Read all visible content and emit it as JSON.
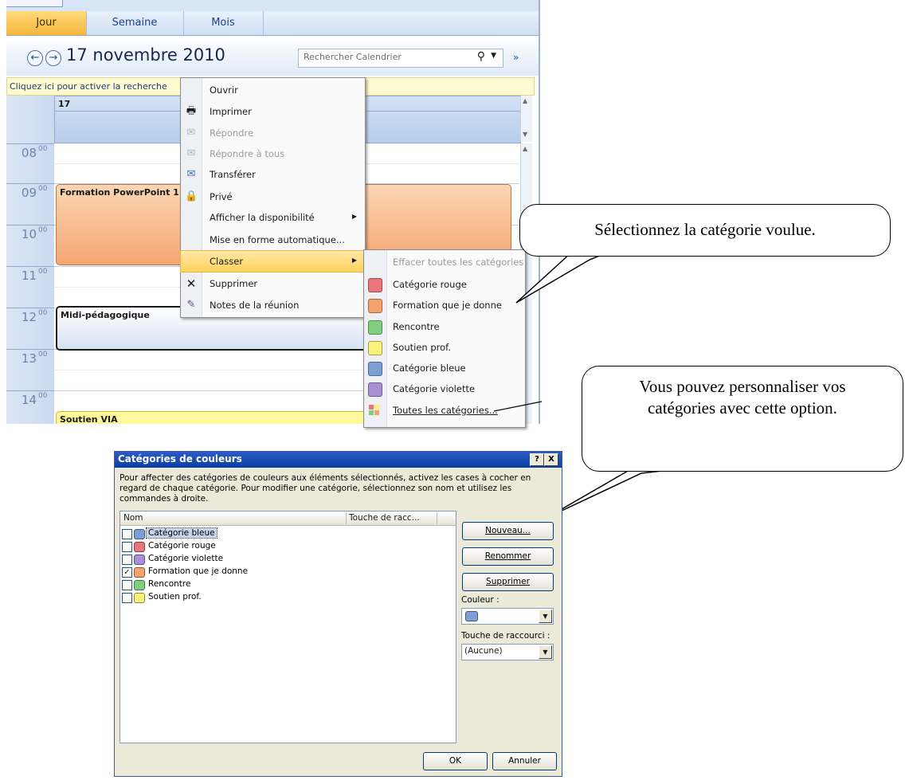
{
  "calendar": {
    "tabs": [
      "Jour",
      "Semaine",
      "Mois"
    ],
    "date_title": "17 novembre 2010",
    "search_placeholder": "Rechercher Calendrier",
    "info_bar": "Cliquez ici pour activer la recherche",
    "day_number": "17",
    "hours": [
      {
        "h": "08",
        "m": "00"
      },
      {
        "h": "09",
        "m": "00"
      },
      {
        "h": "10",
        "m": "00"
      },
      {
        "h": "11",
        "m": "00"
      },
      {
        "h": "12",
        "m": "00"
      },
      {
        "h": "13",
        "m": "00"
      },
      {
        "h": "14",
        "m": "00"
      }
    ],
    "appointments": [
      "Formation PowerPoint 1",
      "Midi-pédagogique",
      "Soutien VIA"
    ]
  },
  "context_menu": {
    "items": [
      {
        "label": "Ouvrir",
        "icon": "none"
      },
      {
        "label": "Imprimer",
        "icon": "printer-icon"
      },
      {
        "label": "Répondre",
        "icon": "reply-icon",
        "disabled": true
      },
      {
        "label": "Répondre à tous",
        "icon": "reply-all-icon",
        "disabled": true
      },
      {
        "label": "Transférer",
        "icon": "forward-icon"
      },
      {
        "label": "Privé",
        "icon": "lock-icon"
      },
      {
        "label": "Afficher la disponibilité",
        "icon": "none",
        "submenu": true
      },
      {
        "label": "Mise en forme automatique...",
        "icon": "none"
      },
      {
        "label": "Classer",
        "icon": "none",
        "submenu": true,
        "highlighted": true
      },
      {
        "label": "Supprimer",
        "icon": "delete-x-icon"
      },
      {
        "label": "Notes de la réunion",
        "icon": "notes-icon"
      }
    ]
  },
  "classify_submenu": {
    "items": [
      {
        "label": "Effacer toutes les catégories",
        "disabled": true
      },
      {
        "label": "Catégorie rouge",
        "color": "#e8767a"
      },
      {
        "label": "Formation que je donne",
        "color": "#f5a26a"
      },
      {
        "label": "Rencontre",
        "color": "#7fcf7f"
      },
      {
        "label": "Soutien prof.",
        "color": "#fbf27a"
      },
      {
        "label": "Catégorie bleue",
        "color": "#7c9fd6"
      },
      {
        "label": "Catégorie violette",
        "color": "#a98fd6"
      },
      {
        "label": "Toutes les catégories...",
        "icon": "all-categories-icon"
      }
    ]
  },
  "callouts": {
    "top": "Sélectionnez la catégorie voulue.",
    "bottom": "Vous pouvez personnaliser vos catégories avec cette option."
  },
  "dialog": {
    "title": "Catégories de couleurs",
    "help_btn": "?",
    "close_btn": "X",
    "instructions": "Pour affecter des catégories de couleurs aux éléments sélectionnés, activez les cases à cocher en regard de chaque catégorie. Pour modifier une catégorie, sélectionnez son nom et utilisez les commandes à droite.",
    "columns": [
      "Nom",
      "Touche de racc..."
    ],
    "rows": [
      {
        "label": "Catégorie bleue",
        "color": "#7c9fd6",
        "checked": false,
        "selected": true
      },
      {
        "label": "Catégorie rouge",
        "color": "#e8767a",
        "checked": false
      },
      {
        "label": "Catégorie violette",
        "color": "#a98fd6",
        "checked": false
      },
      {
        "label": "Formation que je donne",
        "color": "#f5a26a",
        "checked": true
      },
      {
        "label": "Rencontre",
        "color": "#7fcf7f",
        "checked": false
      },
      {
        "label": "Soutien prof.",
        "color": "#fbf27a",
        "checked": false
      }
    ],
    "buttons": {
      "new": "Nouveau...",
      "rename": "Renommer",
      "delete": "Supprimer",
      "ok": "OK",
      "cancel": "Annuler"
    },
    "color_label": "Couleur :",
    "color_value": "#7c9fd6",
    "shortcut_label": "Touche de raccourci :",
    "shortcut_value": "(Aucune)"
  },
  "colors": {
    "outlook_blue": "#15428b",
    "tab_active": "#f6b73c",
    "menu_highlight": "#ffd35c",
    "dialog_title": "#0a3fa2"
  }
}
